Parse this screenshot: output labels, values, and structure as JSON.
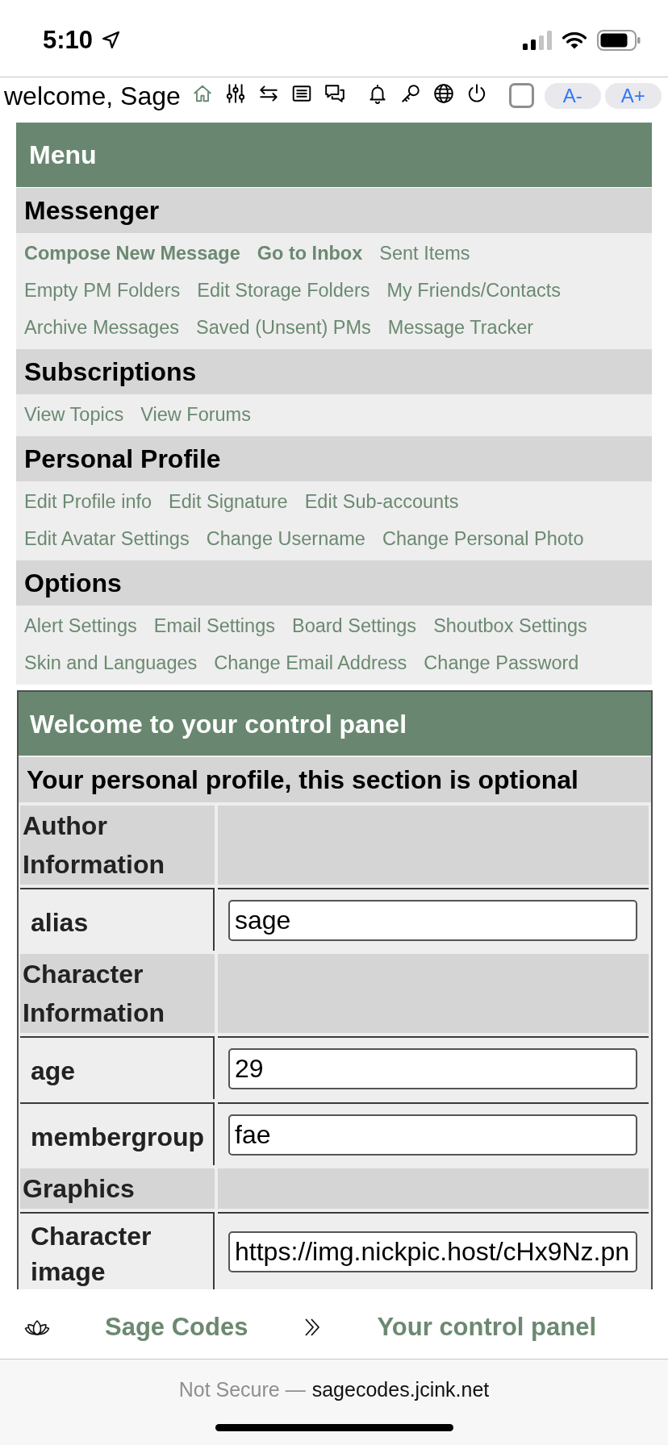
{
  "status_bar": {
    "time": "5:10"
  },
  "toolbar": {
    "greeting": "welcome, Sage",
    "nav_icons": [
      {
        "kind": "home",
        "selected": true
      },
      {
        "kind": "sliders",
        "selected": false
      },
      {
        "kind": "arrows",
        "selected": false
      },
      {
        "kind": "list",
        "selected": false
      },
      {
        "kind": "chat",
        "selected": false
      },
      {
        "kind": "bell",
        "selected": false
      },
      {
        "kind": "key",
        "selected": false
      },
      {
        "kind": "globe",
        "selected": false
      },
      {
        "kind": "power",
        "selected": false
      }
    ],
    "checkbox": {
      "checked": false
    },
    "font_buttons": [
      "A-",
      "A+"
    ]
  },
  "menu": {
    "title": "Menu",
    "sections": [
      {
        "title": "Messenger",
        "links": [
          {
            "label": "Compose New Message",
            "emphasized": true
          },
          {
            "label": "Go to Inbox",
            "emphasized": true
          },
          {
            "label": "Sent Items",
            "emphasized": false
          },
          {
            "label": "Empty PM Folders",
            "emphasized": false
          },
          {
            "label": "Edit Storage Folders",
            "emphasized": false
          },
          {
            "label": "My Friends/Contacts",
            "emphasized": false
          },
          {
            "label": "Archive Messages",
            "emphasized": false
          },
          {
            "label": "Saved (Unsent) PMs",
            "emphasized": false
          },
          {
            "label": "Message Tracker",
            "emphasized": false
          }
        ]
      },
      {
        "title": "Subscriptions",
        "links": [
          {
            "label": "View Topics",
            "emphasized": false
          },
          {
            "label": "View Forums",
            "emphasized": false
          }
        ]
      },
      {
        "title": "Personal Profile",
        "links": [
          {
            "label": "Edit Profile info",
            "emphasized": false
          },
          {
            "label": "Edit Signature",
            "emphasized": false
          },
          {
            "label": "Edit Sub-accounts",
            "emphasized": false
          },
          {
            "label": "Edit Avatar Settings",
            "emphasized": false
          },
          {
            "label": "Change Username",
            "emphasized": false
          },
          {
            "label": "Change Personal Photo",
            "emphasized": false
          }
        ]
      },
      {
        "title": "Options",
        "links": [
          {
            "label": "Alert Settings",
            "emphasized": false
          },
          {
            "label": "Email Settings",
            "emphasized": false
          },
          {
            "label": "Board Settings",
            "emphasized": false
          },
          {
            "label": "Shoutbox Settings",
            "emphasized": false
          },
          {
            "label": "Skin and Languages",
            "emphasized": false
          },
          {
            "label": "Change Email Address",
            "emphasized": false
          },
          {
            "label": "Change Password",
            "emphasized": false
          }
        ]
      }
    ]
  },
  "control_panel": {
    "title": "Welcome to your control panel",
    "subtitle": "Your personal profile, this section is optional",
    "rows": [
      {
        "kind": "group",
        "label": "Author Information"
      },
      {
        "kind": "field",
        "label": "alias",
        "value": "sage"
      },
      {
        "kind": "group",
        "label": "Character Information"
      },
      {
        "kind": "field",
        "label": "age",
        "value": "29"
      },
      {
        "kind": "field",
        "label": "membergroup",
        "value": "fae"
      },
      {
        "kind": "group",
        "label": "Graphics"
      },
      {
        "kind": "field",
        "label": "Character image",
        "value": "https://img.nickpic.host/cHx9Nz.pn"
      }
    ]
  },
  "breadcrumb": {
    "items": [
      "Sage Codes",
      "Your control panel"
    ]
  },
  "browser_bar": {
    "security": "Not Secure —",
    "domain": "sagecodes.jcink.net"
  }
}
